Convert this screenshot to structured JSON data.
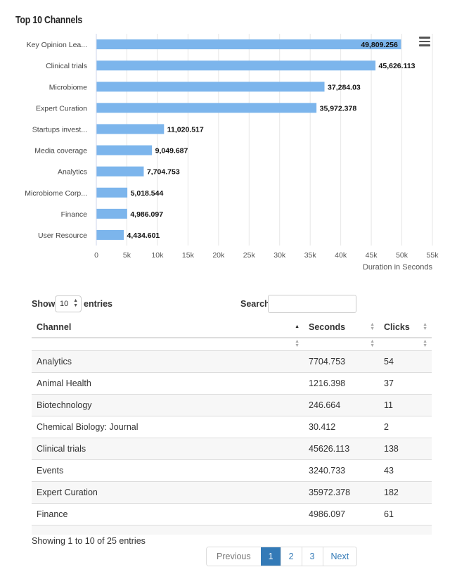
{
  "chart_data": {
    "type": "bar",
    "orientation": "horizontal",
    "title": "Top 10 Channels",
    "categories": [
      "Key Opinion Lea...",
      "Clinical trials",
      "Microbiome",
      "Expert Curation",
      "Startups invest...",
      "Media coverage",
      "Analytics",
      "Microbiome Corp...",
      "Finance",
      "User Resource"
    ],
    "values": [
      49809.256,
      45626.113,
      37284.03,
      35972.378,
      11020.517,
      9049.687,
      7704.753,
      5018.544,
      4986.097,
      4434.601
    ],
    "data_labels": [
      "49,809.256",
      "45,626.113",
      "37,284.03",
      "35,972.378",
      "11,020.517",
      "9,049.687",
      "7,704.753",
      "5,018.544",
      "4,986.097",
      "4,434.601"
    ],
    "xlabel": "Duration in Seconds",
    "xlim": [
      0,
      55000
    ],
    "x_ticks": [
      "0",
      "5k",
      "10k",
      "15k",
      "20k",
      "25k",
      "30k",
      "35k",
      "40k",
      "45k",
      "50k",
      "55k"
    ],
    "bar_color": "#7cb5ec",
    "legend": "none",
    "grid": "vertical"
  },
  "controls": {
    "show_label": "Show",
    "entries_label": "entries",
    "page_length": "10",
    "search_label": "Search:",
    "search_value": ""
  },
  "table": {
    "columns": [
      "Channel",
      "Seconds",
      "Clicks"
    ],
    "rows": [
      [
        "Analytics",
        "7704.753",
        "54"
      ],
      [
        "Animal Health",
        "1216.398",
        "37"
      ],
      [
        "Biotechnology",
        "246.664",
        "11"
      ],
      [
        "Chemical Biology: Journal",
        "30.412",
        "2"
      ],
      [
        "Clinical trials",
        "45626.113",
        "138"
      ],
      [
        "Events",
        "3240.733",
        "43"
      ],
      [
        "Expert Curation",
        "35972.378",
        "182"
      ],
      [
        "Finance",
        "4986.097",
        "61"
      ],
      [
        "",
        "",
        ""
      ]
    ]
  },
  "footer": {
    "info": "Showing 1 to 10 of 25 entries",
    "pages": [
      "Previous",
      "1",
      "2",
      "3",
      "Next"
    ],
    "active_page": "1"
  },
  "icons": {
    "menu": "hamburger-menu-icon",
    "sort": "sort-arrows-icon",
    "select": "select-arrows-icon"
  }
}
